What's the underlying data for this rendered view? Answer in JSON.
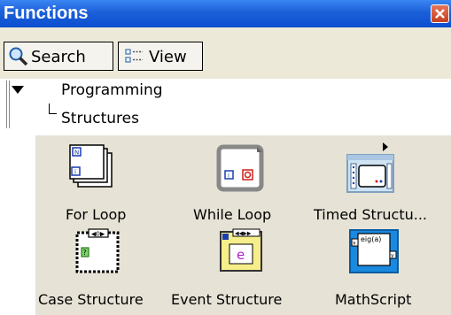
{
  "window": {
    "title": "Functions"
  },
  "toolbar": {
    "search_label": "Search",
    "view_label": "View"
  },
  "tree": {
    "nodes": [
      {
        "label": "Programming"
      },
      {
        "label": "Structures"
      }
    ]
  },
  "palette": {
    "items": [
      {
        "label": "For Loop",
        "icon": "for-loop-icon"
      },
      {
        "label": "While Loop",
        "icon": "while-loop-icon"
      },
      {
        "label": "Timed Structu...",
        "icon": "timed-structure-icon"
      },
      {
        "label": "Case Structure",
        "icon": "case-structure-icon"
      },
      {
        "label": "Event Structure",
        "icon": "event-structure-icon"
      },
      {
        "label": "MathScript",
        "icon": "mathscript-icon"
      }
    ],
    "mathscript_icon_text": "eig(a)"
  },
  "colors": {
    "titlebar": "#0b4fd0",
    "close": "#c4401f",
    "palette_bg": "#e6e3d6"
  }
}
